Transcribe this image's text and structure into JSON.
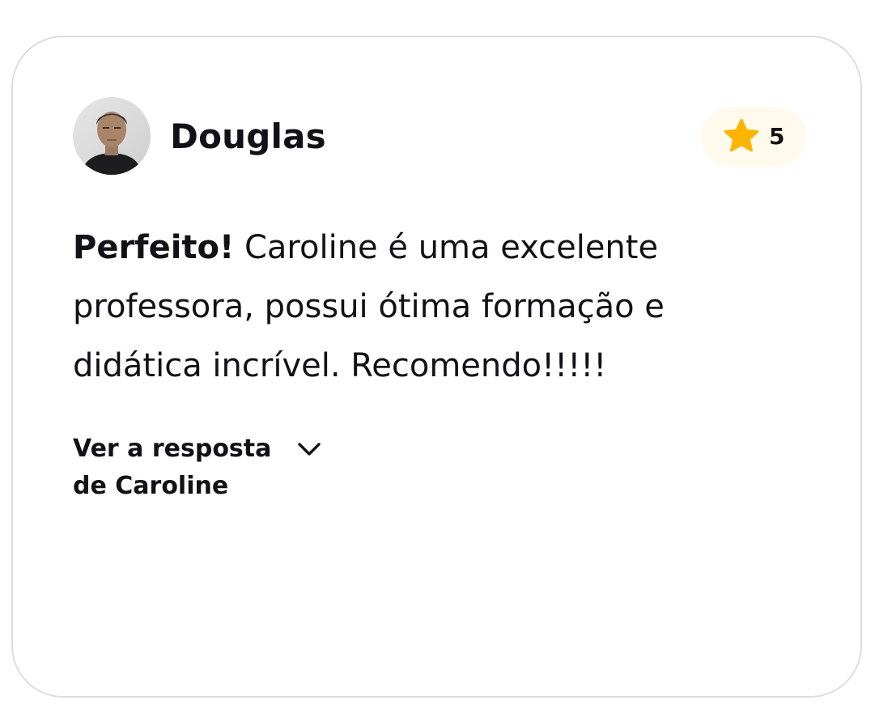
{
  "review": {
    "reviewer_name": "Douglas",
    "rating": "5",
    "rating_icon": "star-icon",
    "title": "Perfeito!",
    "body": "Caroline é uma excelente professora, possui ótima formação e didática incrível. Recomendo!!!!!",
    "reply_toggle_label": "Ver a resposta\nde Caroline",
    "reply_toggle_icon": "chevron-down-icon"
  },
  "colors": {
    "text": "#121117",
    "card_border": "#dcdce5",
    "badge_background": "#fffaeb",
    "star": "#ffb400"
  }
}
